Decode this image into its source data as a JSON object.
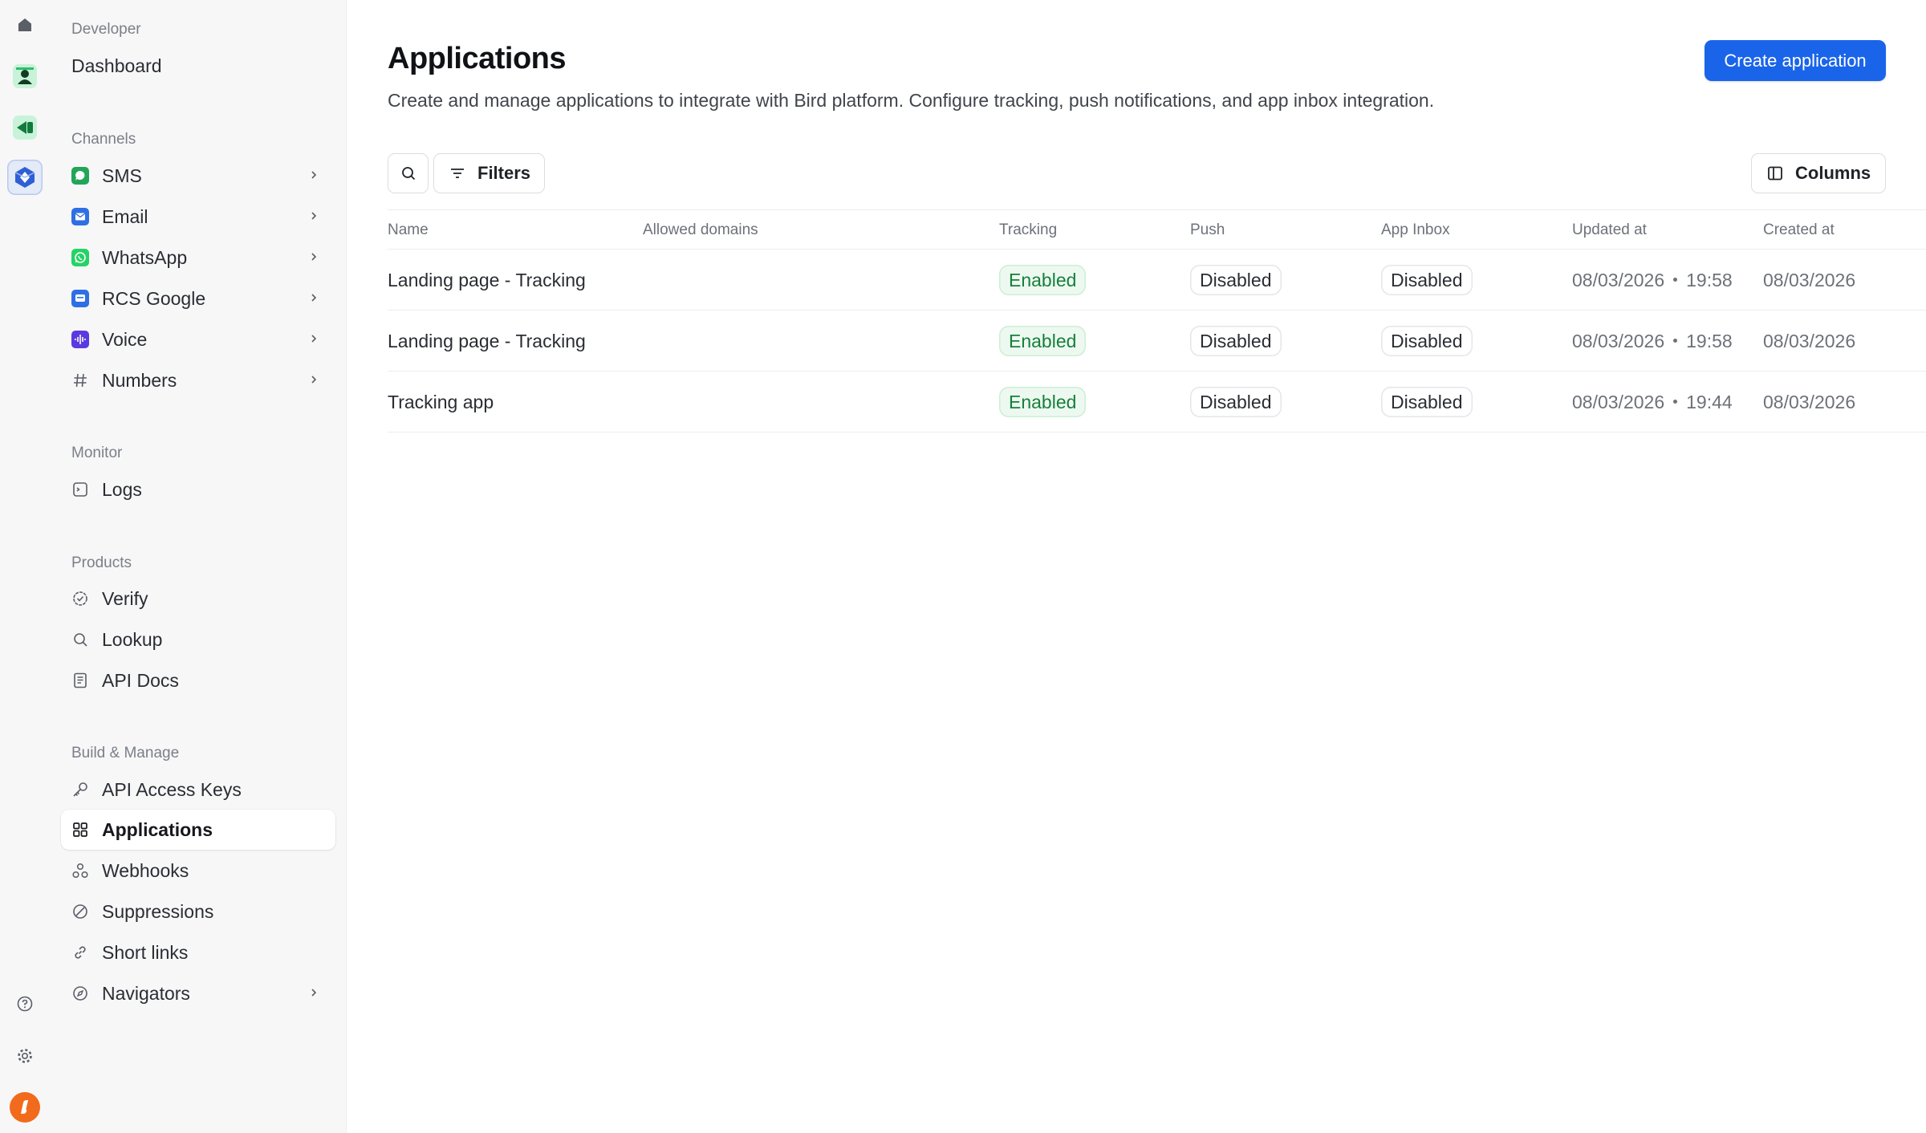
{
  "sidebar": {
    "developer_label": "Developer",
    "dashboard": "Dashboard",
    "channels_label": "Channels",
    "channels": [
      {
        "label": "SMS",
        "icon": "sms-icon",
        "color": "#22a559"
      },
      {
        "label": "Email",
        "icon": "email-icon",
        "color": "#2f6fe4"
      },
      {
        "label": "WhatsApp",
        "icon": "whatsapp-icon",
        "color": "#25d366"
      },
      {
        "label": "RCS Google",
        "icon": "rcs-icon",
        "color": "#2f6fe4"
      },
      {
        "label": "Voice",
        "icon": "voice-icon",
        "color": "#5b3be0"
      },
      {
        "label": "Numbers",
        "icon": "hash-icon"
      }
    ],
    "monitor_label": "Monitor",
    "logs": "Logs",
    "products_label": "Products",
    "products": [
      {
        "label": "Verify",
        "icon": "verify-icon"
      },
      {
        "label": "Lookup",
        "icon": "search-icon"
      },
      {
        "label": "API Docs",
        "icon": "document-icon"
      }
    ],
    "build_label": "Build & Manage",
    "build": [
      {
        "label": "API Access Keys",
        "icon": "key-icon"
      },
      {
        "label": "Applications",
        "icon": "grid-icon",
        "active": true
      },
      {
        "label": "Webhooks",
        "icon": "webhook-icon"
      },
      {
        "label": "Suppressions",
        "icon": "block-icon"
      },
      {
        "label": "Short links",
        "icon": "link-icon"
      },
      {
        "label": "Navigators",
        "icon": "compass-icon"
      }
    ]
  },
  "header": {
    "title": "Applications",
    "subtitle": "Create and manage applications to integrate with Bird platform. Configure tracking, push notifications, and app inbox integration.",
    "create_button": "Create application"
  },
  "toolbar": {
    "filters": "Filters",
    "columns": "Columns"
  },
  "table": {
    "columns": [
      "Name",
      "Allowed domains",
      "Tracking",
      "Push",
      "App Inbox",
      "Updated at",
      "Created at"
    ],
    "rows": [
      {
        "name": "Landing page - Tracking",
        "domains": "",
        "tracking": "Enabled",
        "push": "Disabled",
        "inbox": "Disabled",
        "updated_date": "08/03/2026",
        "updated_time": "19:58",
        "created": "08/03/2026"
      },
      {
        "name": "Landing page - Tracking",
        "domains": "",
        "tracking": "Enabled",
        "push": "Disabled",
        "inbox": "Disabled",
        "updated_date": "08/03/2026",
        "updated_time": "19:58",
        "created": "08/03/2026"
      },
      {
        "name": "Tracking app",
        "domains": "",
        "tracking": "Enabled",
        "push": "Disabled",
        "inbox": "Disabled",
        "updated_date": "08/03/2026",
        "updated_time": "19:44",
        "created": "08/03/2026"
      }
    ]
  },
  "colors": {
    "accent": "#1a64ea",
    "enabled_text": "#16803c",
    "enabled_bg": "#edf9f0"
  }
}
